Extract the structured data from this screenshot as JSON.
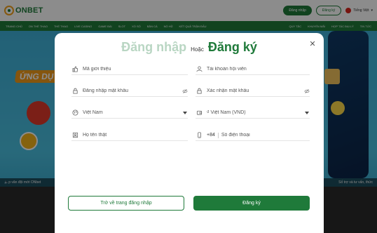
{
  "header": {
    "logo_text": "ONBET",
    "login_label": "Đăng nhập",
    "register_label": "Đăng ký",
    "language_label": "Tiếng Việt"
  },
  "nav": {
    "items": [
      "TRANG CHỦ",
      "ON THỂ THAO",
      "THỂ THAO",
      "LIVE CASINO",
      "GAME BÀI",
      "SLOT",
      "XỔ SỐ",
      "BẮN CÁ",
      "NỔ HŨ",
      "KẾT QUẢ TRẬN ĐẤU"
    ],
    "right_items": [
      "QUY TẮC",
      "KHUYẾN MÃI",
      "HỢP TÁC ĐẠI LÝ",
      "TIN TỨC"
    ]
  },
  "background": {
    "banner_text": "ỨNG DỤ",
    "ticker_left": "p văn đội mới ONbet",
    "ticker_right": "Số trợ và tư vấn, thức"
  },
  "modal": {
    "title_login": "Đăng nhập",
    "title_or": "Hoặc",
    "title_register": "Đăng ký",
    "fields": {
      "referral_code": "Mã giới thiệu",
      "account": "Tài khoản hội viên",
      "password": "Đăng nhập mật khẩu",
      "confirm_password": "Xác nhận mật khẩu",
      "country": "Việt Nam",
      "currency": "₫ Việt Nam (VND)",
      "full_name": "Họ tên thật",
      "phone_prefix": "+84",
      "phone_placeholder": "Số điện thoại"
    },
    "back_label": "Trở về trang đăng nhập",
    "submit_label": "Đăng ký"
  },
  "colors": {
    "brand_green": "#1f7a3a",
    "accent_orange": "#f2a11a"
  }
}
